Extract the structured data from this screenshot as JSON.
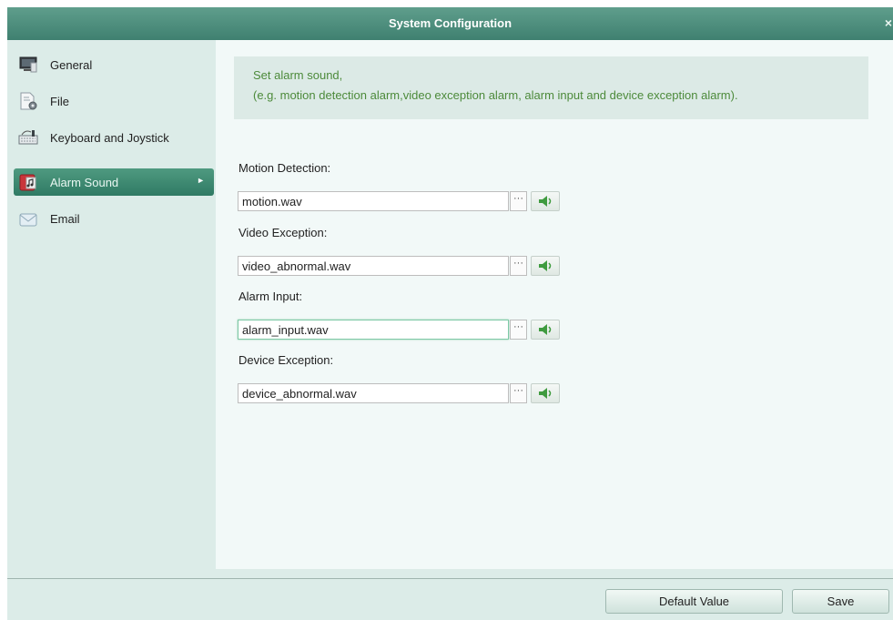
{
  "window": {
    "title": "System Configuration",
    "close_glyph": "×"
  },
  "sidebar": {
    "items": [
      {
        "label": "General",
        "icon": "monitor-icon",
        "active": false
      },
      {
        "label": "File",
        "icon": "file-gear-icon",
        "active": false
      },
      {
        "label": "Keyboard and Joystick",
        "icon": "keyboard-icon",
        "active": false
      },
      {
        "label": "Alarm Sound",
        "icon": "alarm-sound-icon",
        "active": true
      },
      {
        "label": "Email",
        "icon": "envelope-icon",
        "active": false
      }
    ],
    "active_arrow": "►"
  },
  "content": {
    "info_line1": "Set alarm sound,",
    "info_line2": "(e.g. motion detection alarm,video exception alarm, alarm input and device exception alarm).",
    "fields": [
      {
        "label": "Motion Detection:",
        "value": "motion.wav"
      },
      {
        "label": "Video Exception:",
        "value": "video_abnormal.wav"
      },
      {
        "label": "Alarm Input:",
        "value": "alarm_input.wav"
      },
      {
        "label": "Device Exception:",
        "value": "device_abnormal.wav"
      }
    ],
    "browse_label": "···"
  },
  "footer": {
    "default_label": "Default Value",
    "save_label": "Save"
  },
  "colors": {
    "titlebar": "#3f8070",
    "active_item": "#2f7a64",
    "info_text": "#4c8a3a",
    "window_bg": "#dcece8"
  }
}
